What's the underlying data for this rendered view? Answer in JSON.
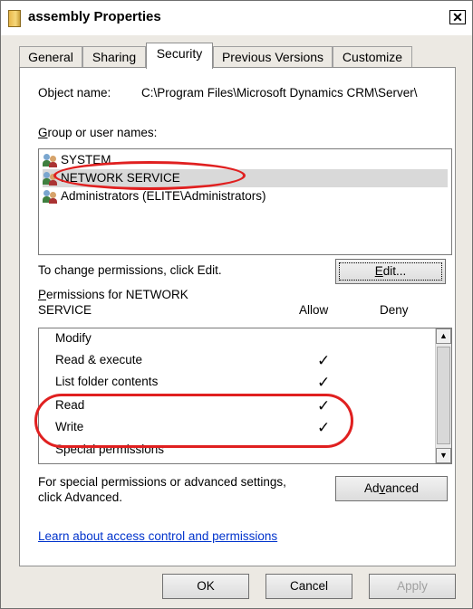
{
  "window": {
    "title": "assembly Properties",
    "close_glyph": "✕"
  },
  "tabs": [
    "General",
    "Sharing",
    "Security",
    "Previous Versions",
    "Customize"
  ],
  "security": {
    "object_name_label": "Object name:",
    "object_name_value": "C:\\Program Files\\Microsoft Dynamics CRM\\Server\\",
    "group_label_u": "G",
    "group_label_rest": "roup or user names:",
    "users": [
      {
        "name": "SYSTEM",
        "selected": false
      },
      {
        "name": "NETWORK SERVICE",
        "selected": true
      },
      {
        "name": "Administrators (ELITE\\Administrators)",
        "selected": false
      }
    ],
    "change_permissions_text": "To change permissions, click Edit.",
    "edit_button_u": "E",
    "edit_button_rest": "dit...",
    "permissions_for_u": "P",
    "permissions_for_rest": "ermissions for NETWORK",
    "permissions_for_line2": "SERVICE",
    "allow_header": "Allow",
    "deny_header": "Deny",
    "permissions": [
      {
        "name": "Modify",
        "allow": ""
      },
      {
        "name": "Read & execute",
        "allow": "✓"
      },
      {
        "name": "List folder contents",
        "allow": "✓"
      },
      {
        "name": "Read",
        "allow": "✓"
      },
      {
        "name": "Write",
        "allow": "✓"
      },
      {
        "name": "Special permissions",
        "allow": ""
      }
    ],
    "special_text_line1": "For special permissions or advanced settings,",
    "special_text_line2": "click Advanced.",
    "advanced_button_pre": "Ad",
    "advanced_button_u": "v",
    "advanced_button_post": "anced",
    "learn_link": "Learn about access control and permissions"
  },
  "footer": {
    "ok": "OK",
    "cancel": "Cancel",
    "apply": "Apply"
  },
  "colors": {
    "annotation": "#e02020",
    "link": "#0033cc",
    "selection": "#d9d9d9"
  },
  "icons": [
    "folder-icon",
    "close-icon",
    "users-icon",
    "scroll-up-arrow-icon",
    "scroll-down-arrow-icon",
    "checkmark-icon"
  ]
}
